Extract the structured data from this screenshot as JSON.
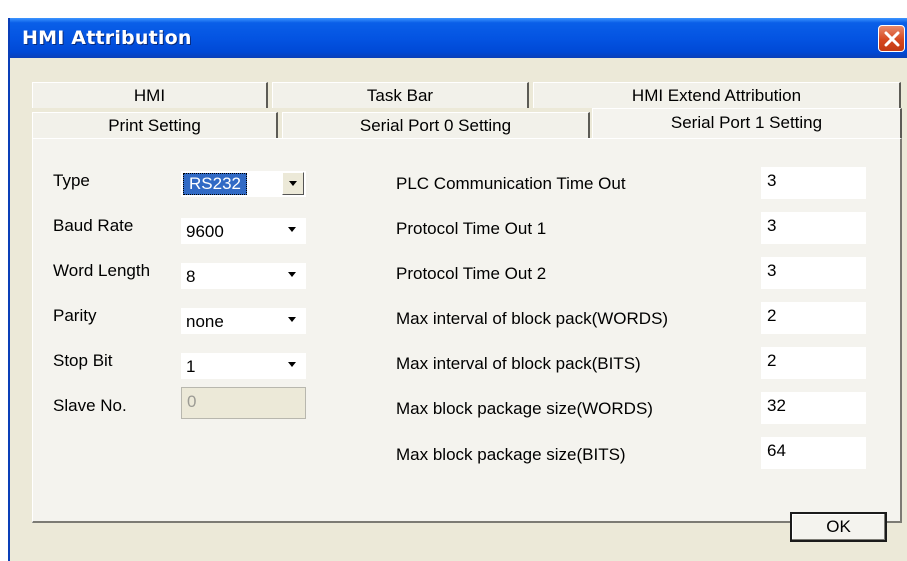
{
  "window": {
    "title": "HMI Attribution"
  },
  "tabs": {
    "row_back": [
      {
        "label": "HMI"
      },
      {
        "label": "Task Bar"
      },
      {
        "label": "HMI Extend Attribution"
      }
    ],
    "row_front": [
      {
        "label": "Print Setting"
      },
      {
        "label": "Serial Port 0 Setting"
      },
      {
        "label": "Serial Port 1 Setting",
        "active": true
      }
    ]
  },
  "left_fields": [
    {
      "label": "Type",
      "value": "RS232",
      "options_visible": [
        "RS232"
      ],
      "focused": true
    },
    {
      "label": "Baud Rate",
      "value": "9600"
    },
    {
      "label": "Word Length",
      "value": "8"
    },
    {
      "label": "Parity",
      "value": "none"
    },
    {
      "label": "Stop Bit",
      "value": "1"
    },
    {
      "label": "Slave No.",
      "value": "0",
      "disabled": true
    }
  ],
  "right_fields": [
    {
      "label": "PLC Communication Time Out",
      "value": "3"
    },
    {
      "label": "Protocol Time Out 1",
      "value": "3"
    },
    {
      "label": "Protocol Time Out 2",
      "value": "3"
    },
    {
      "label": "Max interval of block pack(WORDS)",
      "value": "2"
    },
    {
      "label": "Max interval of block pack(BITS)",
      "value": "2"
    },
    {
      "label": "Max block package size(WORDS)",
      "value": "32"
    },
    {
      "label": "Max block package size(BITS)",
      "value": "64"
    }
  ],
  "buttons": {
    "ok_label": "OK"
  },
  "colors": {
    "titlebar": "#0454e2",
    "dialog_face": "#ece9d8",
    "selection": "#316ac5",
    "close_button": "#d6481f"
  },
  "icons": {
    "close": "close-x-icon",
    "dropdown": "chevron-down-icon"
  }
}
